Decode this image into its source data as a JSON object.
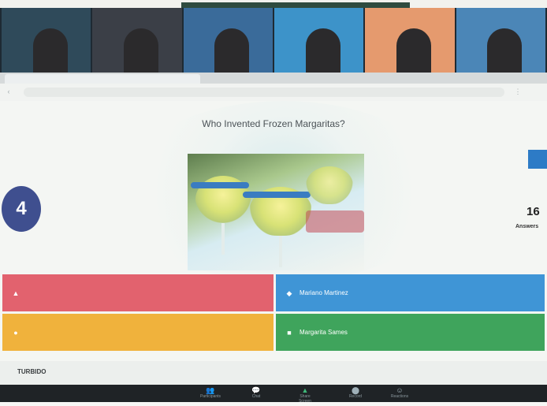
{
  "meeting": {
    "participants": [
      {
        "name": "",
        "bg": "#2f4a5a"
      },
      {
        "name": "",
        "bg": "#3b3f47"
      },
      {
        "name": "",
        "bg": "#3a6b9a"
      },
      {
        "name": "",
        "bg": "#3d93c9"
      },
      {
        "name": "",
        "bg": "#e59a6e"
      },
      {
        "name": "",
        "bg": "#4b86b7"
      }
    ]
  },
  "browser": {
    "tabs": [
      "",
      ""
    ],
    "address": ""
  },
  "quiz": {
    "question": "Who Invented Frozen Margaritas?",
    "timer": "4",
    "answers_count": "16",
    "answers_label": "Answers",
    "answers": [
      {
        "color": "#e2626e",
        "shape": "triangle-icon",
        "label": ""
      },
      {
        "color": "#3f95d6",
        "shape": "diamond-icon",
        "label": "Mariano Martinez"
      },
      {
        "color": "#f0b23c",
        "shape": "circle-icon",
        "label": ""
      },
      {
        "color": "#3fa45c",
        "shape": "square-icon",
        "label": "Margarita Sames"
      }
    ],
    "footer": "TURBIDO"
  },
  "toolbar": {
    "items": [
      {
        "icon": "participants-icon",
        "label": "Participants"
      },
      {
        "icon": "chat-icon",
        "label": "Chat"
      },
      {
        "icon": "share-screen-icon",
        "label": "Share Screen"
      },
      {
        "icon": "record-icon",
        "label": "Record"
      },
      {
        "icon": "reactions-icon",
        "label": "Reactions"
      }
    ]
  }
}
